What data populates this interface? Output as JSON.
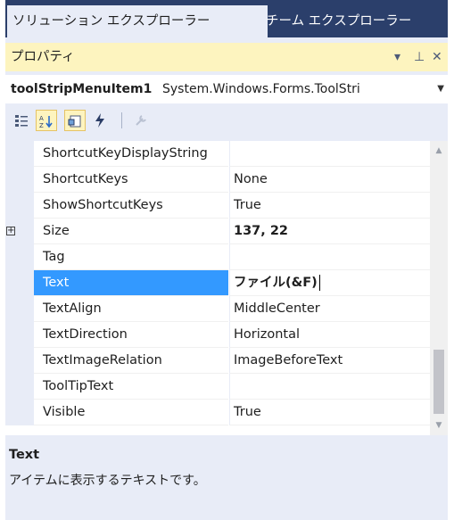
{
  "tabs": [
    {
      "label": "ソリューション エクスプローラー",
      "active": true
    },
    {
      "label": "チーム エクスプローラー",
      "active": false
    }
  ],
  "panel": {
    "title": "プロパティ",
    "dropdown_icon": "▾",
    "pin_icon": "⊥",
    "close_icon": "✕"
  },
  "selector": {
    "object_name": "toolStripMenuItem1",
    "object_type": "System.Windows.Forms.ToolStri"
  },
  "toolbar": {
    "buttons": [
      "categorized-icon",
      "alphabetical-icon",
      "properties-icon",
      "events-icon",
      "property-pages-icon"
    ]
  },
  "properties": [
    {
      "name": "ShortcutKeyDisplayString",
      "value": ""
    },
    {
      "name": "ShortcutKeys",
      "value": "None"
    },
    {
      "name": "ShowShortcutKeys",
      "value": "True"
    },
    {
      "name": "Size",
      "value": "137, 22"
    },
    {
      "name": "Tag",
      "value": ""
    },
    {
      "name": "Text",
      "value": "ファイル(&F)"
    },
    {
      "name": "TextAlign",
      "value": "MiddleCenter"
    },
    {
      "name": "TextDirection",
      "value": "Horizontal"
    },
    {
      "name": "TextImageRelation",
      "value": "ImageBeforeText"
    },
    {
      "name": "ToolTipText",
      "value": ""
    },
    {
      "name": "Visible",
      "value": "True"
    }
  ],
  "description": {
    "title": "Text",
    "text": "アイテムに表示するテキストです。"
  },
  "colors": {
    "tab_strip": "#2b3f6b",
    "panel_header": "#fdf4bf",
    "selection": "#3399ff",
    "background": "#e8ecf7"
  }
}
